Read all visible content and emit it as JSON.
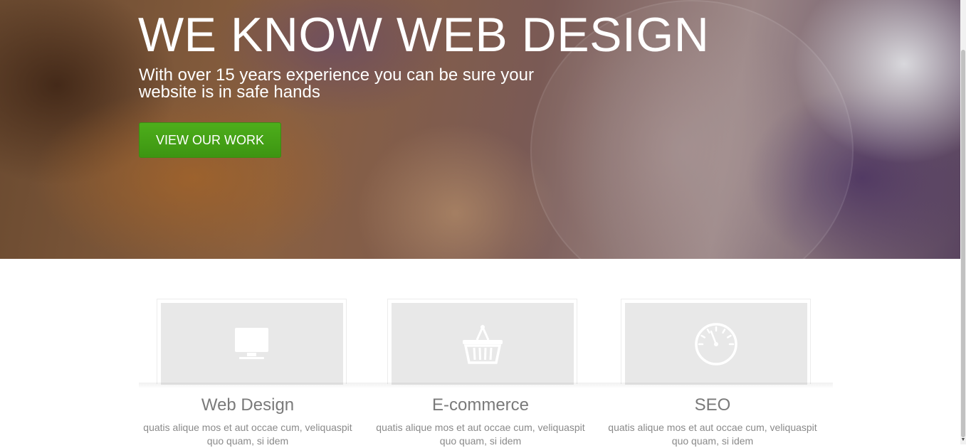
{
  "hero": {
    "title": "WE KNOW WEB DESIGN",
    "subtitle": "With over 15 years experience you can be sure your website is in safe hands",
    "button_label": "VIEW OUR WORK",
    "button_color": "#44a515"
  },
  "services": [
    {
      "title": "Web Design",
      "icon": "monitor-icon",
      "text": "quatis alique mos et aut occae cum, veliquaspit quo quam, si idem"
    },
    {
      "title": "E-commerce",
      "icon": "shopping-basket-icon",
      "text": "quatis alique mos et aut occae cum, veliquaspit quo quam, si idem"
    },
    {
      "title": "SEO",
      "icon": "speedometer-icon",
      "text": "quatis alique mos et aut occae cum, veliquaspit quo quam, si idem"
    }
  ]
}
